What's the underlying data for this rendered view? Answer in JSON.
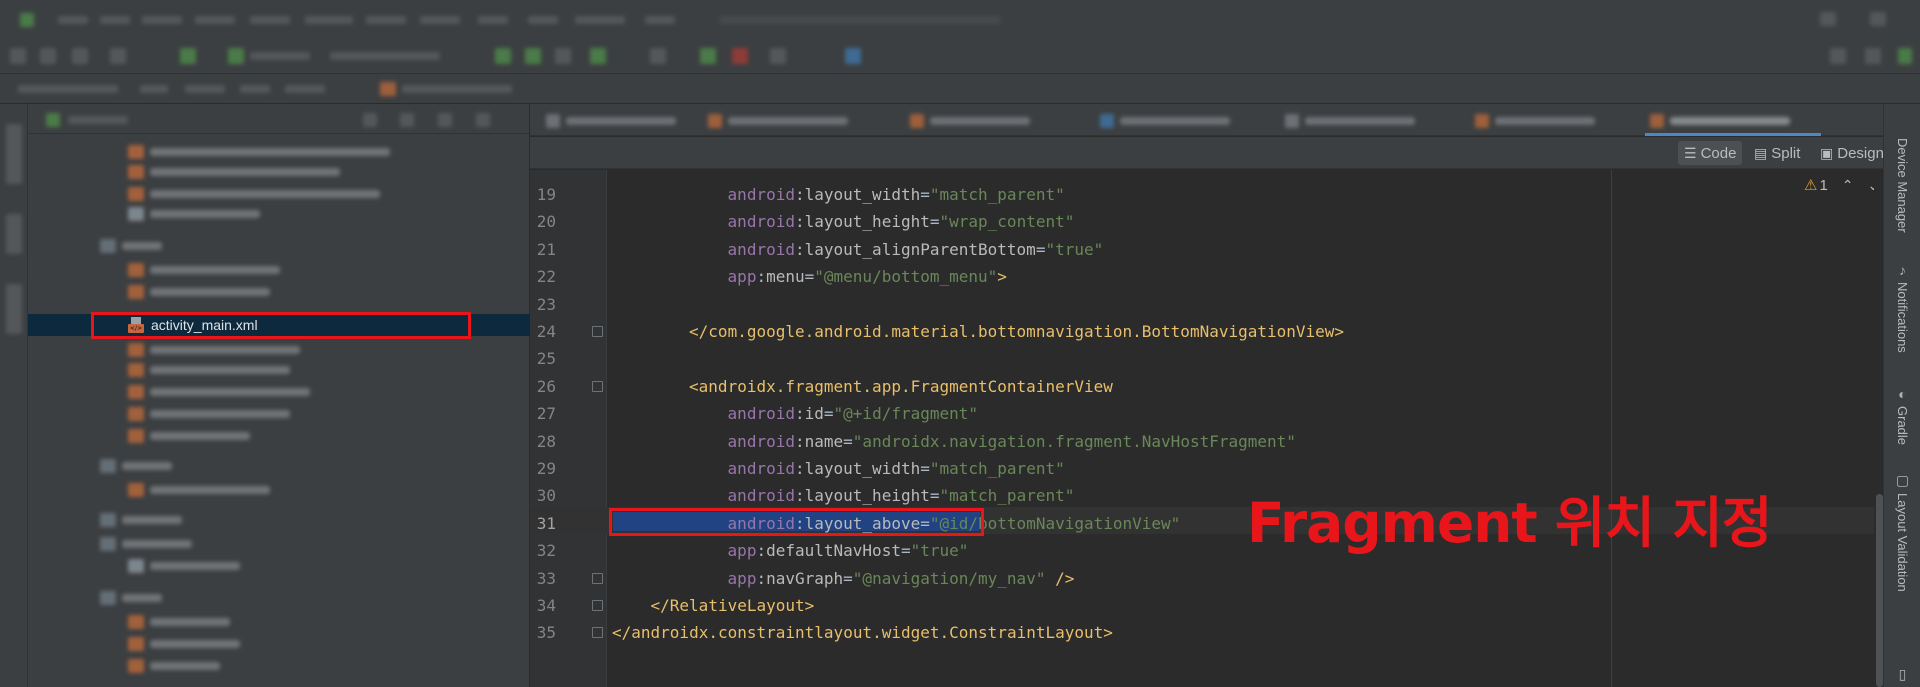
{
  "project_tree": {
    "selected_file": "activity_main.xml"
  },
  "editor": {
    "view_modes": [
      {
        "label": "Code",
        "icon": "list-icon"
      },
      {
        "label": "Split",
        "icon": "split-icon"
      },
      {
        "label": "Design",
        "icon": "image-icon"
      }
    ],
    "inspection": {
      "warning_count": "1",
      "up": "⌃",
      "down": "⌄"
    },
    "lines": [
      {
        "n": "19",
        "indent": 12,
        "parts": [
          [
            "ns",
            "android"
          ],
          [
            "punc",
            ":"
          ],
          [
            "attr",
            "layout_width"
          ],
          [
            "punc",
            "="
          ],
          [
            "str",
            "\"match_parent\""
          ]
        ]
      },
      {
        "n": "20",
        "indent": 12,
        "parts": [
          [
            "ns",
            "android"
          ],
          [
            "punc",
            ":"
          ],
          [
            "attr",
            "layout_height"
          ],
          [
            "punc",
            "="
          ],
          [
            "str",
            "\"wrap_content\""
          ]
        ]
      },
      {
        "n": "21",
        "indent": 12,
        "parts": [
          [
            "ns",
            "android"
          ],
          [
            "punc",
            ":"
          ],
          [
            "attr",
            "layout_alignParentBottom"
          ],
          [
            "punc",
            "="
          ],
          [
            "str",
            "\"true\""
          ]
        ]
      },
      {
        "n": "22",
        "indent": 12,
        "parts": [
          [
            "ns",
            "app"
          ],
          [
            "punc",
            ":"
          ],
          [
            "attr",
            "menu"
          ],
          [
            "punc",
            "="
          ],
          [
            "str",
            "\"@menu/bottom_menu\""
          ],
          [
            "tag",
            ">"
          ]
        ]
      },
      {
        "n": "23",
        "indent": 0,
        "parts": []
      },
      {
        "n": "24",
        "indent": 8,
        "fold": true,
        "parts": [
          [
            "tag",
            "</com.google.android.material.bottomnavigation.BottomNavigationView>"
          ]
        ]
      },
      {
        "n": "25",
        "indent": 0,
        "parts": []
      },
      {
        "n": "26",
        "indent": 8,
        "fold": true,
        "parts": [
          [
            "tag",
            "<androidx.fragment.app.FragmentContainerView"
          ]
        ]
      },
      {
        "n": "27",
        "indent": 12,
        "parts": [
          [
            "ns",
            "android"
          ],
          [
            "punc",
            ":"
          ],
          [
            "attr",
            "id"
          ],
          [
            "punc",
            "="
          ],
          [
            "str",
            "\"@+id/fragment\""
          ]
        ]
      },
      {
        "n": "28",
        "indent": 12,
        "parts": [
          [
            "ns",
            "android"
          ],
          [
            "punc",
            ":"
          ],
          [
            "attr",
            "name"
          ],
          [
            "punc",
            "="
          ],
          [
            "str",
            "\"androidx.navigation.fragment.NavHostFragment\""
          ]
        ]
      },
      {
        "n": "29",
        "indent": 12,
        "parts": [
          [
            "ns",
            "android"
          ],
          [
            "punc",
            ":"
          ],
          [
            "attr",
            "layout_width"
          ],
          [
            "punc",
            "="
          ],
          [
            "str",
            "\"match_parent\""
          ]
        ]
      },
      {
        "n": "30",
        "indent": 12,
        "parts": [
          [
            "ns",
            "android"
          ],
          [
            "punc",
            ":"
          ],
          [
            "attr",
            "layout_height"
          ],
          [
            "punc",
            "="
          ],
          [
            "str",
            "\"match_parent\""
          ]
        ]
      },
      {
        "n": "31",
        "indent": 12,
        "current": true,
        "parts": [
          [
            "ns",
            "android"
          ],
          [
            "punc",
            ":"
          ],
          [
            "attr",
            "layout_above"
          ],
          [
            "punc",
            "="
          ],
          [
            "str",
            "\"@id/bottomNavigationView\""
          ]
        ]
      },
      {
        "n": "32",
        "indent": 12,
        "parts": [
          [
            "ns",
            "app"
          ],
          [
            "punc",
            ":"
          ],
          [
            "attr",
            "defaultNavHost"
          ],
          [
            "punc",
            "="
          ],
          [
            "str",
            "\"true\""
          ]
        ]
      },
      {
        "n": "33",
        "indent": 12,
        "fold": true,
        "parts": [
          [
            "ns",
            "app"
          ],
          [
            "punc",
            ":"
          ],
          [
            "attr",
            "navGraph"
          ],
          [
            "punc",
            "="
          ],
          [
            "str",
            "\"@navigation/my_nav\""
          ],
          [
            "tag",
            " />"
          ]
        ]
      },
      {
        "n": "34",
        "indent": 4,
        "fold": true,
        "parts": [
          [
            "tag",
            "</RelativeLayout>"
          ]
        ]
      },
      {
        "n": "35",
        "indent": 0,
        "fold": true,
        "parts": [
          [
            "tag",
            "</androidx.constraintlayout.widget.ConstraintLayout>"
          ]
        ]
      }
    ]
  },
  "annotation": "Fragment 위치 지정",
  "right_tools": [
    {
      "label": "Device Manager",
      "icon": "device-icon"
    },
    {
      "label": "Notifications",
      "icon": "bell-icon"
    },
    {
      "label": "Gradle",
      "icon": "gradle-icon"
    },
    {
      "label": "Layout Validation",
      "icon": "layout-validation-icon"
    }
  ],
  "colors": {
    "highlight_box": "#e8161b",
    "selection": "#214283",
    "tag": "#e8bf6a",
    "string": "#6a8759",
    "namespace": "#9876aa"
  }
}
